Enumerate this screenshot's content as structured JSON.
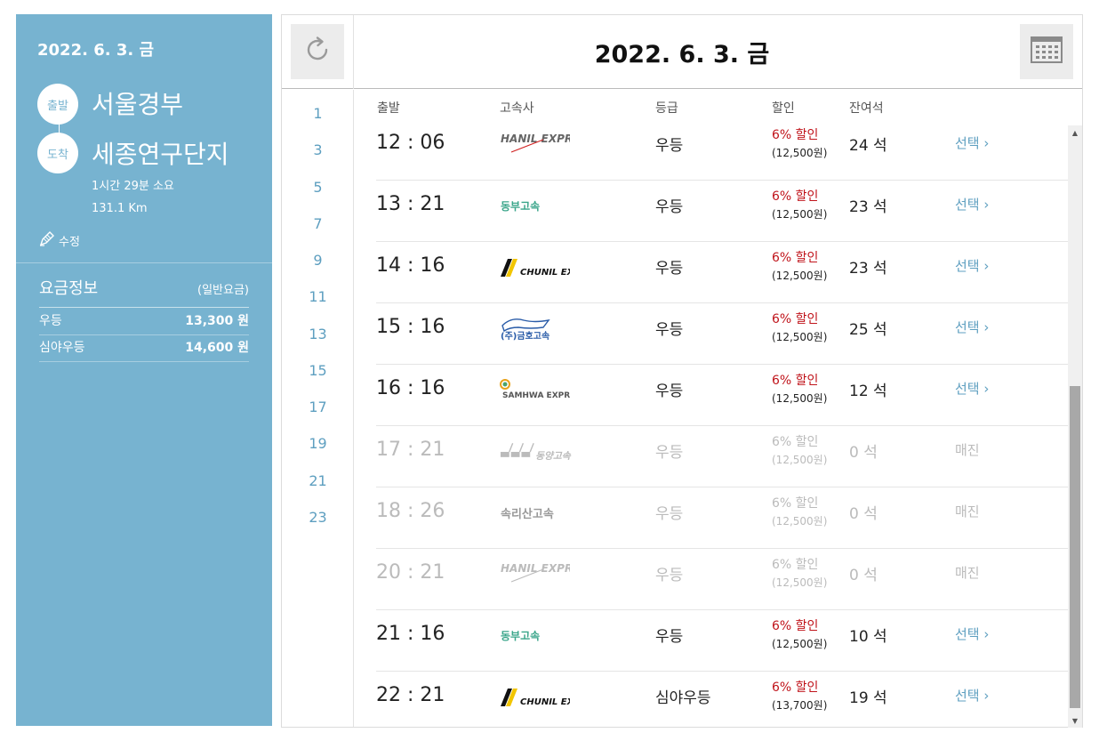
{
  "sidebar": {
    "date": "2022. 6. 3. 금",
    "departure_badge": "출발",
    "departure": "서울경부",
    "arrival_badge": "도착",
    "arrival": "세종연구단지",
    "duration": "1시간 29분 소요",
    "distance": "131.1 Km",
    "edit_label": "수정",
    "fare": {
      "title": "요금정보",
      "type": "(일반요금)",
      "rows": [
        {
          "grade": "우등",
          "price": "13,300 원"
        },
        {
          "grade": "심야우등",
          "price": "14,600 원"
        }
      ]
    }
  },
  "main": {
    "date": "2022. 6. 3. 금",
    "hours": [
      "1",
      "3",
      "5",
      "7",
      "9",
      "11",
      "13",
      "15",
      "17",
      "19",
      "21",
      "23"
    ],
    "columns": {
      "departure": "출발",
      "company": "고속사",
      "grade": "등급",
      "discount": "할인",
      "seats": "잔여석"
    },
    "rows": [
      {
        "time": "12 : 06",
        "company": "HANIL EXPRESS",
        "grade": "우등",
        "discount": "6% 할인",
        "discount_price": "(12,500원)",
        "seats": "24 석",
        "action": "선택"
      },
      {
        "time": "13 : 21",
        "company": "동부고속",
        "grade": "우등",
        "discount": "6% 할인",
        "discount_price": "(12,500원)",
        "seats": "23 석",
        "action": "선택"
      },
      {
        "time": "14 : 16",
        "company": "CHUNIL EXPRESS",
        "grade": "우등",
        "discount": "6% 할인",
        "discount_price": "(12,500원)",
        "seats": "23 석",
        "action": "선택"
      },
      {
        "time": "15 : 16",
        "company": "(주)금호고속",
        "grade": "우등",
        "discount": "6% 할인",
        "discount_price": "(12,500원)",
        "seats": "25 석",
        "action": "선택"
      },
      {
        "time": "16 : 16",
        "company": "SAMHWA EXPRESS",
        "grade": "우등",
        "discount": "6% 할인",
        "discount_price": "(12,500원)",
        "seats": "12 석",
        "action": "선택"
      },
      {
        "time": "17 : 21",
        "company": "동양고속",
        "grade": "우등",
        "discount": "6% 할인",
        "discount_price": "(12,500원)",
        "seats": "0 석",
        "action": "매진"
      },
      {
        "time": "18 : 26",
        "company": "속리산고속",
        "grade": "우등",
        "discount": "6% 할인",
        "discount_price": "(12,500원)",
        "seats": "0 석",
        "action": "매진"
      },
      {
        "time": "20 : 21",
        "company": "HANIL EXPRESS",
        "grade": "우등",
        "discount": "6% 할인",
        "discount_price": "(12,500원)",
        "seats": "0 석",
        "action": "매진"
      },
      {
        "time": "21 : 16",
        "company": "동부고속",
        "grade": "우등",
        "discount": "6% 할인",
        "discount_price": "(12,500원)",
        "seats": "10 석",
        "action": "선택"
      },
      {
        "time": "22 : 21",
        "company": "CHUNIL EXPRESS",
        "grade": "심야우등",
        "discount": "6% 할인",
        "discount_price": "(13,700원)",
        "seats": "19 석",
        "action": "선택"
      }
    ]
  },
  "colors": {
    "sidebar_bg": "#77b3d0",
    "accent": "#5e9fc0",
    "discount": "#c0141b",
    "soldout": "#bbbbbb",
    "dongbu_logo": "#3aa58a",
    "chunil_logo": "#f2c500"
  },
  "icons": {
    "refresh": "refresh-icon",
    "calendar": "calendar-icon",
    "edit": "pencil-icon",
    "chevron": "chevron-right-icon"
  }
}
